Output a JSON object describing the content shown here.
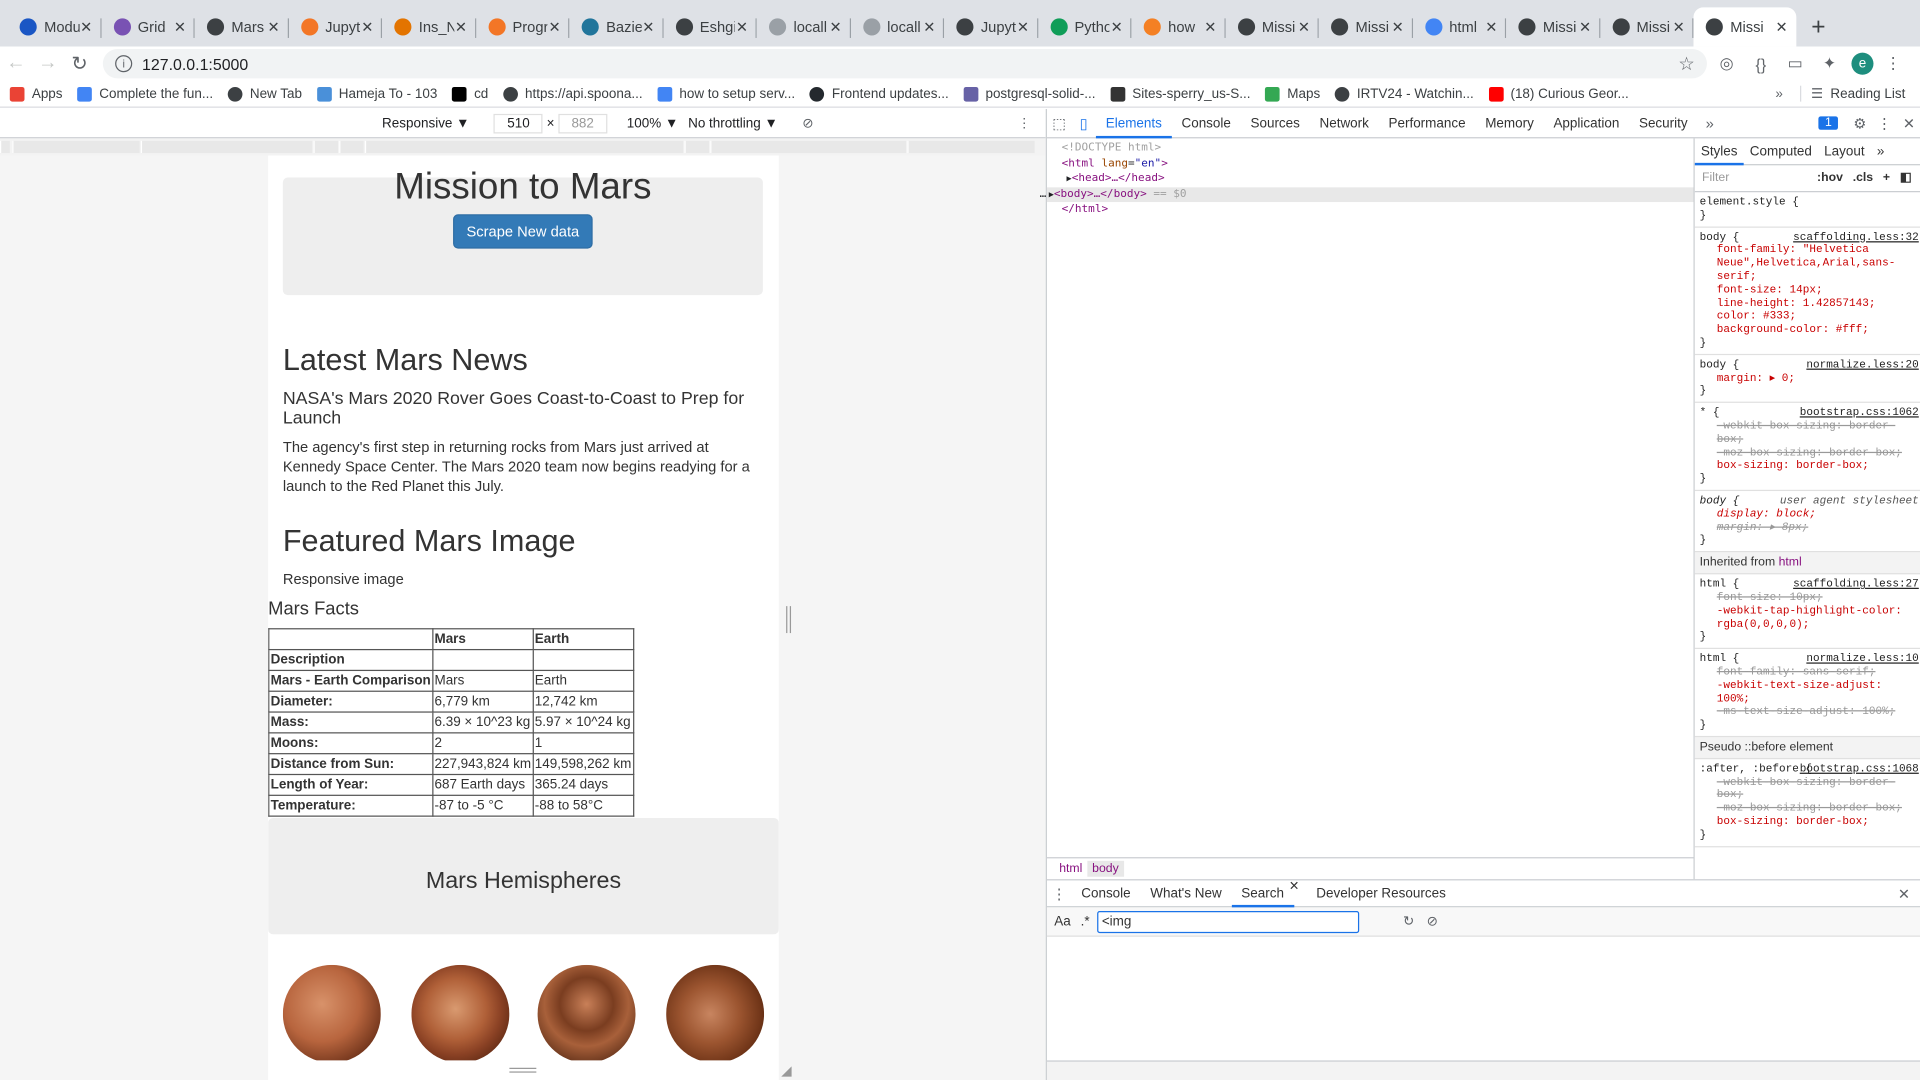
{
  "tabs": [
    {
      "title": "Modu",
      "icon": "wix-icon",
      "color": "#1a56c4"
    },
    {
      "title": "Grid",
      "icon": "bootstrap-icon",
      "color": "#7952b3"
    },
    {
      "title": "Mars",
      "icon": "globe-icon",
      "color": "#3c4043"
    },
    {
      "title": "Jupyt",
      "icon": "jupyter-icon",
      "color": "#f37626"
    },
    {
      "title": "Ins_N",
      "icon": "notebook-icon",
      "color": "#e37400"
    },
    {
      "title": "Progr",
      "icon": "jupyter-icon",
      "color": "#f37626"
    },
    {
      "title": "Bazie",
      "icon": "wordpress-icon",
      "color": "#21759b"
    },
    {
      "title": "Eshgi",
      "icon": "globe-icon",
      "color": "#3c4043"
    },
    {
      "title": "locall",
      "icon": "loading-icon",
      "color": "#9aa0a6"
    },
    {
      "title": "locall",
      "icon": "loading-icon",
      "color": "#9aa0a6"
    },
    {
      "title": "Jupyt",
      "icon": "globe-icon",
      "color": "#3c4043"
    },
    {
      "title": "Pytho",
      "icon": "python-icon",
      "color": "#0f9d58"
    },
    {
      "title": "how",
      "icon": "stackoverflow-icon",
      "color": "#f48024"
    },
    {
      "title": "Missi",
      "icon": "globe-icon",
      "color": "#3c4043"
    },
    {
      "title": "Missi",
      "icon": "globe-icon",
      "color": "#3c4043"
    },
    {
      "title": "html",
      "icon": "google-icon",
      "color": "#4285f4"
    },
    {
      "title": "Missi",
      "icon": "globe-icon",
      "color": "#3c4043"
    },
    {
      "title": "Missi",
      "icon": "globe-icon",
      "color": "#3c4043"
    },
    {
      "title": "Missi",
      "icon": "globe-icon",
      "color": "#3c4043",
      "active": true
    }
  ],
  "address": {
    "url": "127.0.0.1:5000"
  },
  "profile": {
    "initial": "e"
  },
  "bookmarks": [
    {
      "label": "Apps",
      "icon": "apps-grid-icon"
    },
    {
      "label": "Complete the fun...",
      "icon": "google-icon"
    },
    {
      "label": "New Tab",
      "icon": "globe-icon"
    },
    {
      "label": "Hameja To - 103",
      "icon": "image-icon"
    },
    {
      "label": "cd",
      "icon": "d-icon"
    },
    {
      "label": "https://api.spoona...",
      "icon": "globe-icon"
    },
    {
      "label": "how to setup serv...",
      "icon": "google-icon"
    },
    {
      "label": "Frontend updates...",
      "icon": "github-icon"
    },
    {
      "label": "postgresql-solid-...",
      "icon": "heroku-icon"
    },
    {
      "label": "Sites-sperry_us-S...",
      "icon": "diamond-icon"
    },
    {
      "label": "Maps",
      "icon": "maps-icon"
    },
    {
      "label": "IRTV24 - Watchin...",
      "icon": "globe-icon"
    },
    {
      "label": "(18) Curious Geor...",
      "icon": "youtube-icon"
    }
  ],
  "reading_list": "Reading List",
  "device_toolbar": {
    "mode": "Responsive ▼",
    "width": "510",
    "height": "882",
    "zoom": "100% ▼",
    "throttle": "No throttling ▼"
  },
  "page": {
    "title": "Mission to Mars",
    "scrape_button": "Scrape New data",
    "news_heading": "Latest Mars News",
    "news_title": "NASA's Mars 2020 Rover Goes Coast-to-Coast to Prep for Launch",
    "news_body": "The agency's first step in returning rocks from Mars just arrived at Kennedy Space Center. The Mars 2020 team now begins readying for a launch to the Red Planet this July.",
    "featured_heading": "Featured Mars Image",
    "featured_alt": "Responsive image",
    "facts_heading": "Mars Facts",
    "facts_header": [
      "",
      "Mars",
      "Earth"
    ],
    "facts_rows": [
      [
        "Description",
        "",
        ""
      ],
      [
        "Mars - Earth Comparison",
        "Mars",
        "Earth"
      ],
      [
        "Diameter:",
        "6,779 km",
        "12,742 km"
      ],
      [
        "Mass:",
        "6.39 × 10^23 kg",
        "5.97 × 10^24 kg"
      ],
      [
        "Moons:",
        "2",
        "1"
      ],
      [
        "Distance from Sun:",
        "227,943,824 km",
        "149,598,262 km"
      ],
      [
        "Length of Year:",
        "687 Earth days",
        "365.24 days"
      ],
      [
        "Temperature:",
        "-87 to -5 °C",
        "-88 to 58°C"
      ]
    ],
    "hemispheres_heading": "Mars Hemispheres"
  },
  "devtools": {
    "tabs": [
      "Elements",
      "Console",
      "Sources",
      "Network",
      "Performance",
      "Memory",
      "Application",
      "Security"
    ],
    "active_tab": "Elements",
    "messages": "1",
    "dom": {
      "doctype": "<!DOCTYPE html>",
      "html_open": "<html",
      "lang_attr": "lang",
      "lang_val": "\"en\"",
      "gt": ">",
      "head": "<head>…</head>",
      "body": "<body>…</body>",
      "body_eq": "== $0",
      "html_close": "</html>",
      "dots": "…"
    },
    "crumbs": [
      "html",
      "body"
    ],
    "styles_tabs": [
      "Styles",
      "Computed",
      "Layout",
      "»"
    ],
    "filter_placeholder": "Filter",
    "hov": ":hov",
    "cls": ".cls",
    "rules": {
      "element_style": "element.style {",
      "r1_sel": "body {",
      "r1_src": "scaffolding.less:32",
      "r1_p1": "font-family: \"Helvetica Neue\",Helvetica,Arial,sans-serif;",
      "r1_p2": "font-size: 14px;",
      "r1_p3": "line-height: 1.42857143;",
      "r1_p4": "color: #333;",
      "r1_p5": "background-color: #fff;",
      "r2_sel": "body {",
      "r2_src": "normalize.less:20",
      "r2_p1": "margin: ▸ 0;",
      "r3_sel": "* {",
      "r3_src": "bootstrap.css:1062",
      "r3_p1": "-webkit-box-sizing: border-box;",
      "r3_p2": "-moz-box-sizing: border-box;",
      "r3_p3": "box-sizing: border-box;",
      "r4_sel": "body {",
      "r4_src": "user agent stylesheet",
      "r4_p1": "display: block;",
      "r4_p2": "margin: ▸ 8px;",
      "inherited": "Inherited from",
      "inherited_tag": "html",
      "r5_sel": "html {",
      "r5_src": "scaffolding.less:27",
      "r5_p1": "font-size: 10px;",
      "r5_p2": "-webkit-tap-highlight-color: rgba(0,0,0,0);",
      "r6_sel": "html {",
      "r6_src": "normalize.less:10",
      "r6_p1": "font-family: sans-serif;",
      "r6_p2": "-webkit-text-size-adjust: 100%;",
      "r6_p3": "-ms-text-size-adjust: 100%;",
      "pseudo": "Pseudo ::before element",
      "r7_sel": ":after, :before {",
      "r7_src": "bootstrap.css:1068",
      "r7_p1": "-webkit-box-sizing: border-box;",
      "r7_p2": "-moz-box-sizing: border-box;",
      "r7_p3": "box-sizing: border-box;",
      "close": "}"
    },
    "drawer_tabs": [
      "Console",
      "What's New",
      "Search",
      "Developer Resources"
    ],
    "drawer_active": "Search",
    "search_aa": "Aa",
    "search_regex": ".*",
    "search_value": "<img"
  }
}
